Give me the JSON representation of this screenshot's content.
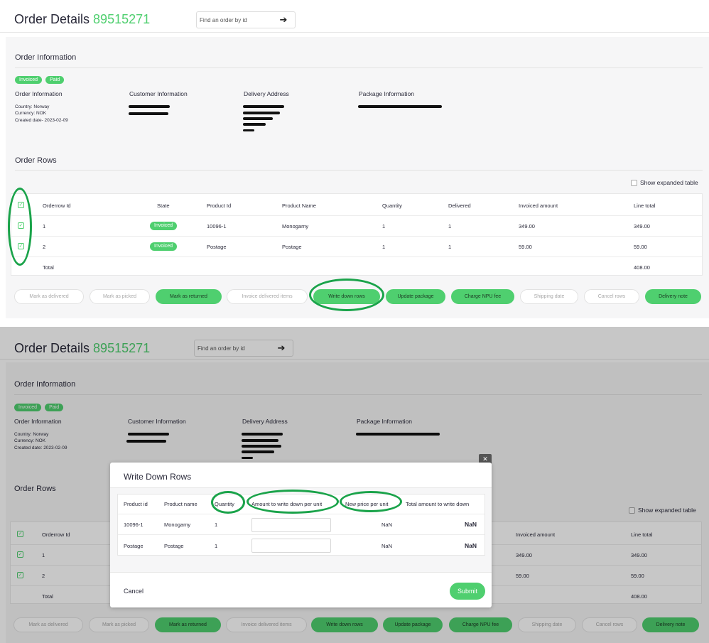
{
  "header": {
    "title": "Order Details",
    "order_number": "89515271",
    "search_placeholder": "Find an order by id",
    "search_button_icon": "arrow-right-icon"
  },
  "order_information": {
    "section_title": "Order Information",
    "badges": [
      "Invoiced",
      "Paid"
    ],
    "columns": {
      "order_info": "Order Information",
      "customer_info": "Customer Information",
      "delivery_address": "Delivery Address",
      "package_info": "Package Information"
    },
    "country": "Country: Norway",
    "currency": "Currency: NOK",
    "created_date_top": "Created date- 2023-02-09",
    "created_date_bottom": "Created date: 2023-02-09"
  },
  "order_rows": {
    "section_title": "Order Rows",
    "show_expanded_label": "Show expanded table",
    "headers": [
      "Orderrow Id",
      "State",
      "Product Id",
      "Product Name",
      "Quantity",
      "Delivered",
      "Invoiced amount",
      "Line total"
    ],
    "rows": [
      {
        "id": "1",
        "state": "Invoiced",
        "product_id": "10096-1",
        "product_name": "Monogamy",
        "quantity": "1",
        "delivered": "1",
        "invoiced_amount": "349.00",
        "line_total": "349.00"
      },
      {
        "id": "2",
        "state": "Invoiced",
        "product_id": "Postage",
        "product_name": "Postage",
        "quantity": "1",
        "delivered": "1",
        "invoiced_amount": "59.00",
        "line_total": "59.00"
      }
    ],
    "total_label": "Total",
    "total_value": "408.00"
  },
  "actions": [
    {
      "label": "Mark as delivered",
      "enabled": false
    },
    {
      "label": "Mark as picked",
      "enabled": false
    },
    {
      "label": "Mark as returned",
      "enabled": true
    },
    {
      "label": "Invoice delivered items",
      "enabled": false
    },
    {
      "label": "Write down rows",
      "enabled": true
    },
    {
      "label": "Update package",
      "enabled": true
    },
    {
      "label": "Charge NPU fee",
      "enabled": true
    },
    {
      "label": "Shipping date",
      "enabled": false
    },
    {
      "label": "Cancel rows",
      "enabled": false
    },
    {
      "label": "Delivery note",
      "enabled": true
    }
  ],
  "modal": {
    "title": "Write Down Rows",
    "close_icon": "close-icon",
    "headers": [
      "Product id",
      "Product name",
      "Quantity",
      "Amount to write down per unit",
      "New price per unit",
      "Total amount to write down"
    ],
    "rows": [
      {
        "product_id": "10096-1",
        "product_name": "Monogamy",
        "quantity": "1",
        "new_price": "NaN",
        "total": "NaN"
      },
      {
        "product_id": "Postage",
        "product_name": "Postage",
        "quantity": "1",
        "new_price": "NaN",
        "total": "NaN"
      }
    ],
    "cancel_label": "Cancel",
    "submit_label": "Submit"
  },
  "colors": {
    "accent": "#4fcf6f",
    "annotation": "#1aa34a"
  }
}
